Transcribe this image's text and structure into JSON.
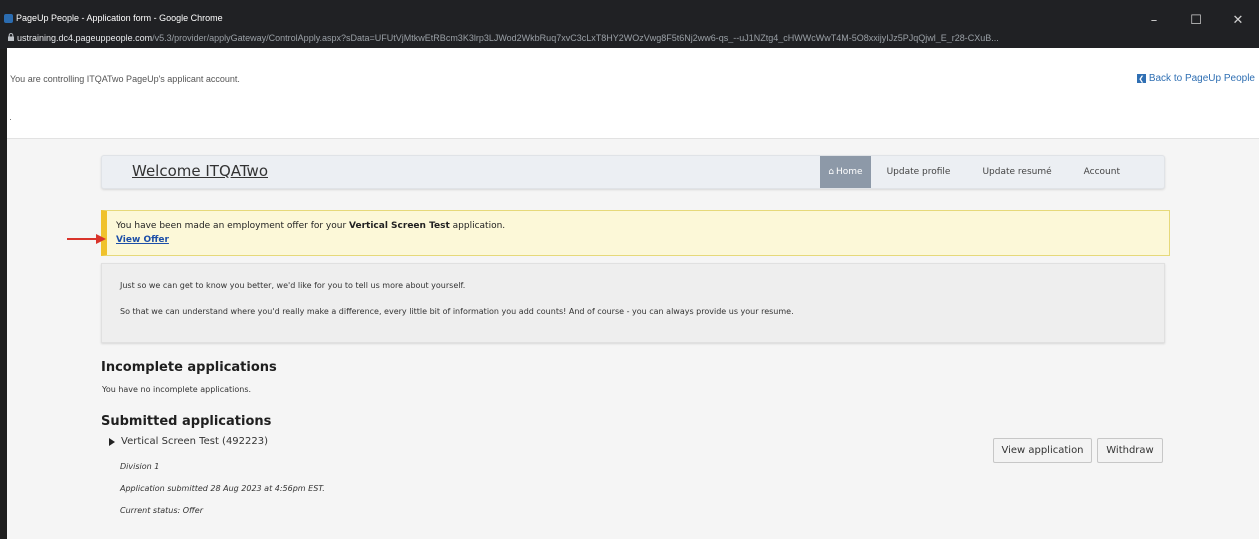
{
  "window": {
    "title": "PageUp People - Application form - Google Chrome",
    "controls": {
      "minimize": "–",
      "maximize": "☐",
      "close": "✕"
    }
  },
  "address_bar": {
    "host": "ustraining.dc4.pageuppeople.com",
    "path": "/v5.3/provider/applyGateway/ControlApply.aspx?sData=UFUtVjMtkwEtRBcm3K3lrp3LJWod2WkbRuq7xvC3cLxT8HY2WOzVwg8F5t6Nj2ww6-qs_--uJ1NZtg4_cHWWcWwT4M-5O8xxijyIJz5PJqQjwl_E_r28-CXuB..."
  },
  "control_banner": {
    "text": "You are controlling ITQATwo PageUp's applicant account.",
    "back_label": "Back to PageUp People",
    "back_icon": "back-arrow-icon"
  },
  "nav": {
    "welcome": "Welcome ITQATwo",
    "items": [
      {
        "label": "Home",
        "icon": "home-icon",
        "active": true
      },
      {
        "label": "Update profile"
      },
      {
        "label": "Update resumé"
      },
      {
        "label": "Account"
      }
    ]
  },
  "offer": {
    "text_before": "You have been made an employment offer for your ",
    "job": "Vertical Screen Test",
    "text_after": " application.",
    "link": "View Offer"
  },
  "about": {
    "line1": "Just so we can get to know you better, we'd like for you to tell us more about yourself.",
    "line2": "So that we can understand where you'd really make a difference, every little bit of information you add counts! And of course - you can always provide us your resume."
  },
  "incomplete": {
    "heading": "Incomplete applications",
    "empty": "You have no incomplete applications."
  },
  "submitted": {
    "heading": "Submitted applications",
    "application": {
      "title": "Vertical Screen Test (492223)",
      "division": "Division 1",
      "submitted": "Application submitted 28 Aug 2023 at 4:56pm EST.",
      "status": "Current status: Offer"
    },
    "buttons": {
      "view": "View application",
      "withdraw": "Withdraw"
    }
  },
  "colors": {
    "accent_link": "#1d4fa8",
    "offer_bg": "#fcf8d8",
    "offer_border": "#f0c22c",
    "annotation_arrow": "#d9342b"
  }
}
